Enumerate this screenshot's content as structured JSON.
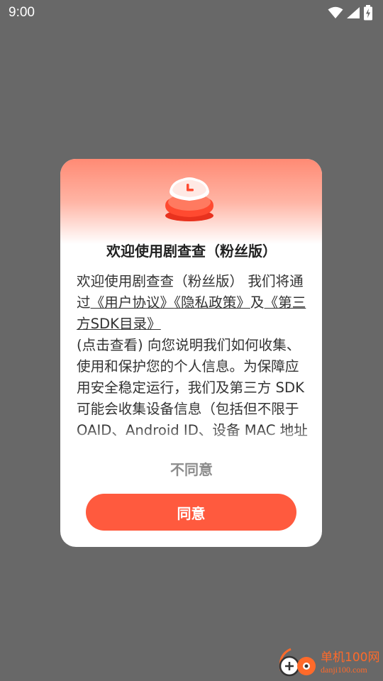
{
  "status_bar": {
    "time": "9:00",
    "icons": [
      "wifi-icon",
      "signal-icon",
      "battery-charging-icon"
    ]
  },
  "dialog": {
    "title": "欢迎使用剧查查（粉丝版）",
    "body": {
      "intro": "欢迎使用剧查查（粉丝版） 我们将通过",
      "link_user_agreement": "《用户协议》",
      "link_privacy": "《隐私政策》",
      "conjunction": "及",
      "link_sdk_list": "《第三方SDK目录》",
      "rest": "(点击查看) 向您说明我们如何收集、使用和保护您的个人信息。为保障应用安全稳定运行，我们及第三方 SDK 可能会收集设备信息（包括但不限于 OAID、Android ID、设备 MAC 地址"
    },
    "disagree_label": "不同意",
    "agree_label": "同意"
  },
  "watermark": {
    "name": "单机100网",
    "url": "danji100.com"
  },
  "colors": {
    "overlay": "#686868",
    "accent": "#ff5a3e",
    "header_gradient_top": "#ff8a74",
    "watermark": "#ff6a2a"
  }
}
